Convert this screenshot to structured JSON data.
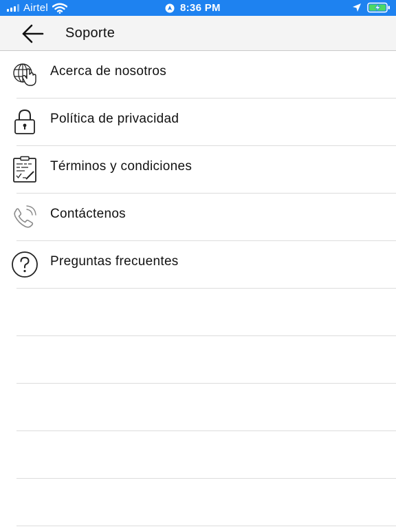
{
  "status_bar": {
    "carrier": "Airtel",
    "time": "8:36 PM",
    "background_color": "#1e82f0",
    "battery_color": "#4cd964",
    "icons": [
      "signal-icon",
      "wifi-icon",
      "alarm-icon",
      "location-arrow-icon",
      "battery-charging-icon"
    ]
  },
  "header": {
    "back_icon": "arrow-left-icon",
    "title": "Soporte"
  },
  "menu": {
    "items": [
      {
        "label": "Acerca de nosotros",
        "icon": "globe-hand-icon"
      },
      {
        "label": "Política de privacidad",
        "icon": "lock-icon"
      },
      {
        "label": "Términos y condiciones",
        "icon": "clipboard-icon"
      },
      {
        "label": "Contáctenos",
        "icon": "phone-icon"
      },
      {
        "label": "Preguntas frecuentes",
        "icon": "question-circle-icon"
      }
    ]
  }
}
